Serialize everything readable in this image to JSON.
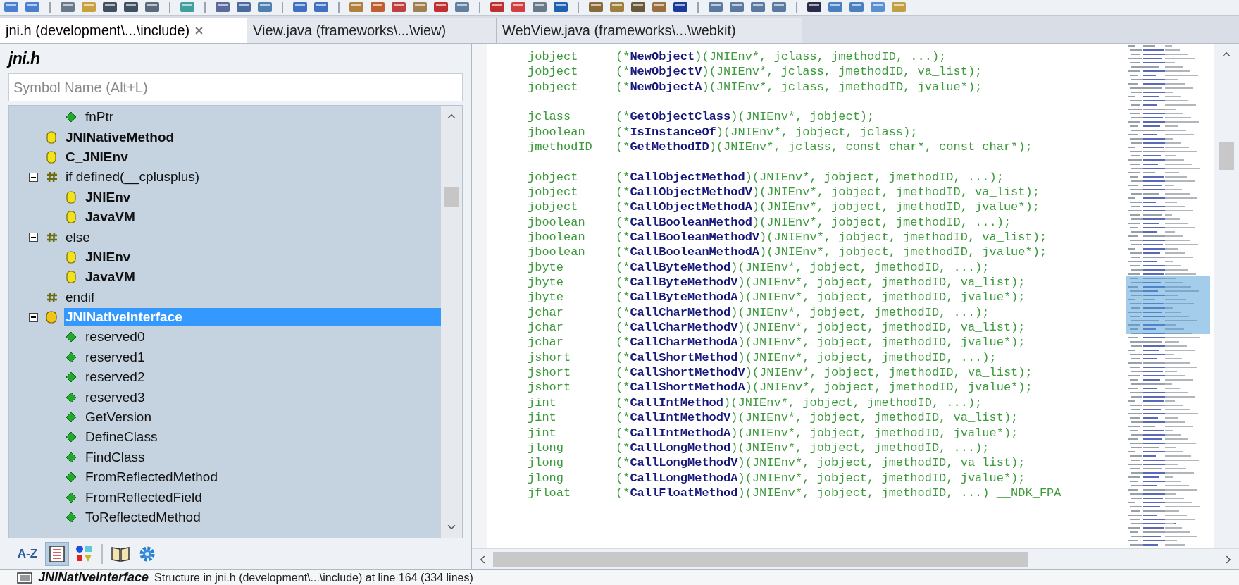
{
  "tabs": [
    {
      "label": "jni.h (development\\...\\include)",
      "selected": true,
      "closable": true
    },
    {
      "label": "View.java (frameworks\\...\\view)",
      "selected": false,
      "closable": false
    },
    {
      "label": "WebView.java (frameworks\\...\\webkit)",
      "selected": false,
      "closable": false
    }
  ],
  "symbol_panel": {
    "title": "jni.h",
    "search": {
      "placeholder": "Symbol Name (Alt+L)"
    },
    "tree": [
      {
        "children": [
          {
            "label": "fnPtr",
            "kind": "member",
            "selected": false
          }
        ]
      },
      {
        "label": "JNINativeMethod",
        "kind": "type",
        "selected": false
      },
      {
        "label": "C_JNIEnv",
        "kind": "type",
        "selected": false
      },
      {
        "label": "if defined(__cplusplus)",
        "kind": "preprocessor",
        "selected": false,
        "expanded": true,
        "children": [
          {
            "label": "JNIEnv",
            "kind": "type",
            "selected": false
          },
          {
            "label": "JavaVM",
            "kind": "type",
            "selected": false
          }
        ]
      },
      {
        "label": "else",
        "kind": "preprocessor",
        "selected": false,
        "expanded": true,
        "children": [
          {
            "label": "JNIEnv",
            "kind": "type",
            "selected": false
          },
          {
            "label": "JavaVM",
            "kind": "type",
            "selected": false
          }
        ]
      },
      {
        "label": "endif",
        "kind": "preprocessor",
        "selected": false
      },
      {
        "label": "JNINativeInterface",
        "kind": "struct",
        "selected": true,
        "expanded": true,
        "children": [
          {
            "label": "reserved0",
            "kind": "member",
            "selected": false
          },
          {
            "label": "reserved1",
            "kind": "member",
            "selected": false
          },
          {
            "label": "reserved2",
            "kind": "member",
            "selected": false
          },
          {
            "label": "reserved3",
            "kind": "member",
            "selected": false
          },
          {
            "label": "GetVersion",
            "kind": "member",
            "selected": false
          },
          {
            "label": "DefineClass",
            "kind": "member",
            "selected": false
          },
          {
            "label": "FindClass",
            "kind": "member",
            "selected": false
          },
          {
            "label": "FromReflectedMethod",
            "kind": "member",
            "selected": false
          },
          {
            "label": "FromReflectedField",
            "kind": "member",
            "selected": false
          },
          {
            "label": "ToReflectedMethod",
            "kind": "member",
            "selected": false
          }
        ]
      }
    ],
    "view_buttons": [
      {
        "kind": "sort",
        "label": "A-Z",
        "selected": false
      },
      {
        "kind": "list",
        "selected": true
      },
      {
        "kind": "categories",
        "selected": false
      },
      {
        "kind": "book",
        "selected": false
      },
      {
        "kind": "settings",
        "selected": false
      }
    ]
  },
  "code": [
    {
      "kind": "declaration",
      "type": "jobject",
      "pre": "(*",
      "name": "NewObject",
      "post": ")(JNIEnv*, jclass, jmethodID, ...);"
    },
    {
      "kind": "declaration",
      "type": "jobject",
      "pre": "(*",
      "name": "NewObjectV",
      "post": ")(JNIEnv*, jclass, jmethodID, va_list);"
    },
    {
      "kind": "declaration",
      "type": "jobject",
      "pre": "(*",
      "name": "NewObjectA",
      "post": ")(JNIEnv*, jclass, jmethodID, jvalue*);"
    },
    {
      "kind": "blank"
    },
    {
      "kind": "declaration",
      "type": "jclass",
      "pre": "(*",
      "name": "GetObjectClass",
      "post": ")(JNIEnv*, jobject);"
    },
    {
      "kind": "declaration",
      "type": "jboolean",
      "pre": "(*",
      "name": "IsInstanceOf",
      "post": ")(JNIEnv*, jobject, jclass);"
    },
    {
      "kind": "declaration",
      "type": "jmethodID",
      "pre": "(*",
      "name": "GetMethodID",
      "post": ")(JNIEnv*, jclass, const char*, const char*);"
    },
    {
      "kind": "blank"
    },
    {
      "kind": "declaration",
      "type": "jobject",
      "pre": "(*",
      "name": "CallObjectMethod",
      "post": ")(JNIEnv*, jobject, jmethodID, ...);"
    },
    {
      "kind": "declaration",
      "type": "jobject",
      "pre": "(*",
      "name": "CallObjectMethodV",
      "post": ")(JNIEnv*, jobject, jmethodID, va_list);"
    },
    {
      "kind": "declaration",
      "type": "jobject",
      "pre": "(*",
      "name": "CallObjectMethodA",
      "post": ")(JNIEnv*, jobject, jmethodID, jvalue*);"
    },
    {
      "kind": "declaration",
      "type": "jboolean",
      "pre": "(*",
      "name": "CallBooleanMethod",
      "post": ")(JNIEnv*, jobject, jmethodID, ...);"
    },
    {
      "kind": "declaration",
      "type": "jboolean",
      "pre": "(*",
      "name": "CallBooleanMethodV",
      "post": ")(JNIEnv*, jobject, jmethodID, va_list);"
    },
    {
      "kind": "declaration",
      "type": "jboolean",
      "pre": "(*",
      "name": "CallBooleanMethodA",
      "post": ")(JNIEnv*, jobject, jmethodID, jvalue*);"
    },
    {
      "kind": "declaration",
      "type": "jbyte",
      "pre": "(*",
      "name": "CallByteMethod",
      "post": ")(JNIEnv*, jobject, jmethodID, ...);"
    },
    {
      "kind": "declaration",
      "type": "jbyte",
      "pre": "(*",
      "name": "CallByteMethodV",
      "post": ")(JNIEnv*, jobject, jmethodID, va_list);"
    },
    {
      "kind": "declaration",
      "type": "jbyte",
      "pre": "(*",
      "name": "CallByteMethodA",
      "post": ")(JNIEnv*, jobject, jmethodID, jvalue*);"
    },
    {
      "kind": "declaration",
      "type": "jchar",
      "pre": "(*",
      "name": "CallCharMethod",
      "post": ")(JNIEnv*, jobject, jmethodID, ...);"
    },
    {
      "kind": "declaration",
      "type": "jchar",
      "pre": "(*",
      "name": "CallCharMethodV",
      "post": ")(JNIEnv*, jobject, jmethodID, va_list);"
    },
    {
      "kind": "declaration",
      "type": "jchar",
      "pre": "(*",
      "name": "CallCharMethodA",
      "post": ")(JNIEnv*, jobject, jmethodID, jvalue*);"
    },
    {
      "kind": "declaration",
      "type": "jshort",
      "pre": "(*",
      "name": "CallShortMethod",
      "post": ")(JNIEnv*, jobject, jmethodID, ...);"
    },
    {
      "kind": "declaration",
      "type": "jshort",
      "pre": "(*",
      "name": "CallShortMethodV",
      "post": ")(JNIEnv*, jobject, jmethodID, va_list);"
    },
    {
      "kind": "declaration",
      "type": "jshort",
      "pre": "(*",
      "name": "CallShortMethodA",
      "post": ")(JNIEnv*, jobject, jmethodID, jvalue*);"
    },
    {
      "kind": "declaration",
      "type": "jint",
      "pre": "(*",
      "name": "CallIntMethod",
      "post": ")(JNIEnv*, jobject, jmethodID, ...);"
    },
    {
      "kind": "declaration",
      "type": "jint",
      "pre": "(*",
      "name": "CallIntMethodV",
      "post": ")(JNIEnv*, jobject, jmethodID, va_list);"
    },
    {
      "kind": "declaration",
      "type": "jint",
      "pre": "(*",
      "name": "CallIntMethodA",
      "post": ")(JNIEnv*, jobject, jmethodID, jvalue*);"
    },
    {
      "kind": "declaration",
      "type": "jlong",
      "pre": "(*",
      "name": "CallLongMethod",
      "post": ")(JNIEnv*, jobject, jmethodID, ...);"
    },
    {
      "kind": "declaration",
      "type": "jlong",
      "pre": "(*",
      "name": "CallLongMethodV",
      "post": ")(JNIEnv*, jobject, jmethodID, va_list);"
    },
    {
      "kind": "declaration",
      "type": "jlong",
      "pre": "(*",
      "name": "CallLongMethodA",
      "post": ")(JNIEnv*, jobject, jmethodID, jvalue*);"
    },
    {
      "kind": "declaration",
      "type": "jfloat",
      "pre": "(*",
      "name": "CallFloatMethod",
      "post": ")(JNIEnv*, jobject, jmethodID, ...) __NDK_FPA"
    }
  ],
  "status_bar": {
    "symbol": "JNINativeInterface",
    "description": "Structure in jni.h (development\\...\\include) at line 164 (334 lines)"
  }
}
